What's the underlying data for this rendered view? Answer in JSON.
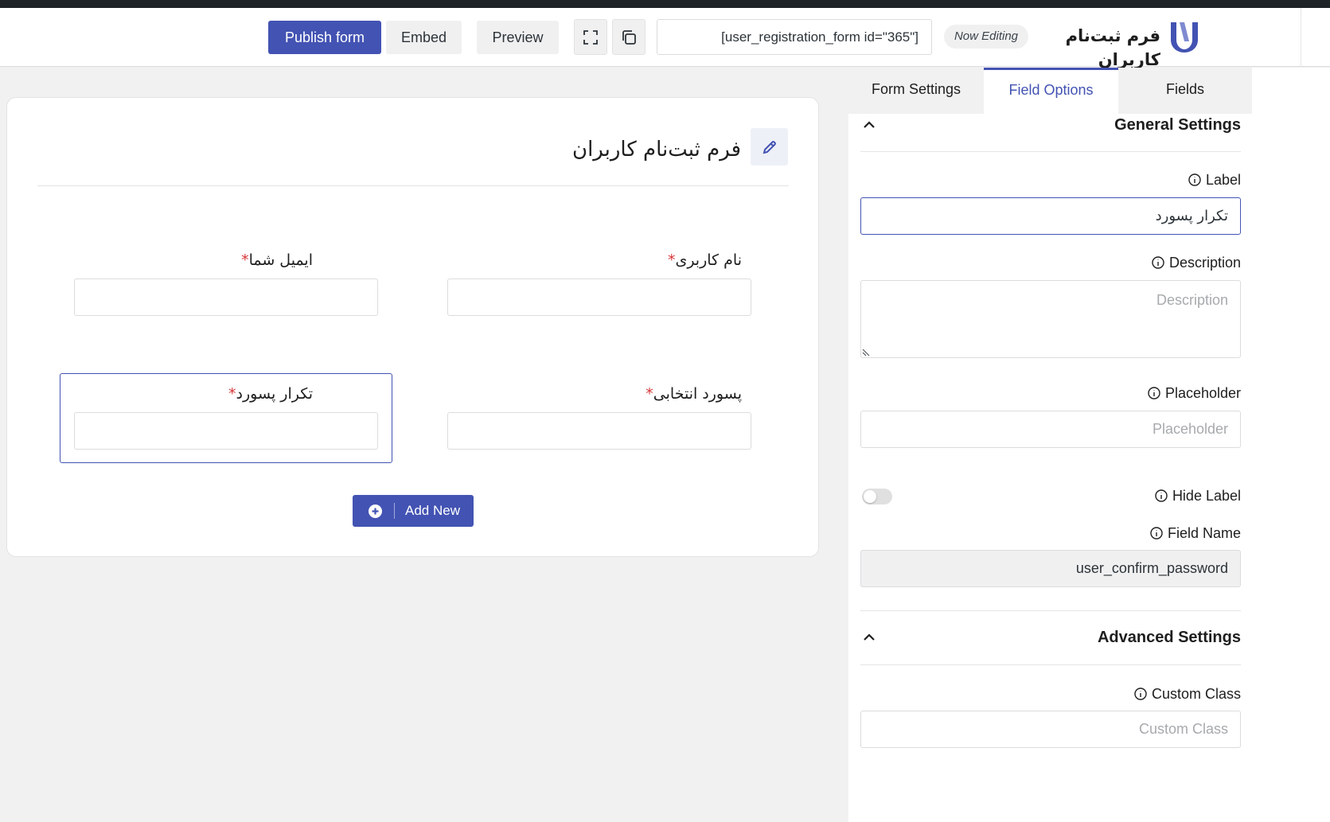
{
  "header": {
    "brand_title": "فرم ثبت‌نام کاربران",
    "now_editing": "Now Editing",
    "shortcode": "[user_registration_form id=\"365\"]",
    "publish_label": "Publish form",
    "embed_label": "Embed",
    "preview_label": "Preview"
  },
  "panel": {
    "tabs": [
      "Form Settings",
      "Field Options",
      "Fields"
    ],
    "active_tab": "Field Options",
    "general_settings": {
      "title": "General Settings",
      "label_caption": "Label",
      "label_value": "تکرار پسورد",
      "description_caption": "Description",
      "description_placeholder": "Description",
      "placeholder_caption": "Placeholder",
      "placeholder_placeholder": "Placeholder",
      "hide_label_caption": "Hide Label",
      "hide_label_on": false,
      "field_name_caption": "Field Name",
      "field_name_value": "user_confirm_password"
    },
    "advanced_settings": {
      "title": "Advanced Settings",
      "custom_class_caption": "Custom Class",
      "custom_class_placeholder": "Custom Class"
    }
  },
  "canvas": {
    "form_title": "فرم ثبت‌نام کاربران",
    "fields": [
      {
        "label": "نام کاربری",
        "required_mark": "*"
      },
      {
        "label": "ایمیل شما",
        "required_mark": "*"
      },
      {
        "label": "پسورد انتخابی",
        "required_mark": "*"
      },
      {
        "label": "تکرار پسورد",
        "required_mark": "*"
      }
    ],
    "add_new_label": "Add New"
  },
  "colors": {
    "accent": "#4353b3",
    "required": "#d63638"
  }
}
